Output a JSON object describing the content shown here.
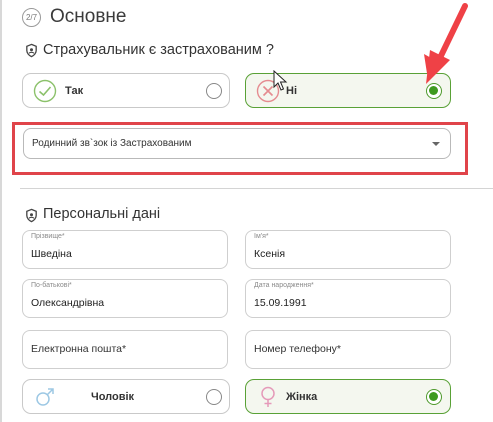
{
  "step": {
    "badge": "2/7",
    "title": "Основне"
  },
  "insured_question": {
    "text": "Страхувальник є застрахованим ?",
    "options": [
      {
        "label": "Так",
        "icon": "check-circle-icon",
        "selected": false
      },
      {
        "label": "Ні",
        "icon": "cross-circle-icon",
        "selected": true
      }
    ]
  },
  "relation_select": {
    "placeholder": "Родинний зв`зок із Застрахованим"
  },
  "personal": {
    "title": "Персональні дані",
    "surname": {
      "label": "Прізвище*",
      "value": "Шведіна"
    },
    "name": {
      "label": "Ім'я*",
      "value": "Ксенія"
    },
    "patronymic": {
      "label": "По-батькові*",
      "value": "Олександрівна"
    },
    "birthdate": {
      "label": "Дата народження*",
      "value": "15.09.1991"
    },
    "email": {
      "placeholder": "Електронна пошта*"
    },
    "phone": {
      "placeholder": "Номер телефону*"
    }
  },
  "gender": {
    "options": [
      {
        "label": "Чоловік",
        "icon": "male-icon",
        "selected": false
      },
      {
        "label": "Жінка",
        "icon": "female-icon",
        "selected": true
      }
    ]
  },
  "colors": {
    "accent_green": "#3e9a1f",
    "highlight_red": "#e0444a",
    "annotation_arrow": "#ef4146"
  }
}
